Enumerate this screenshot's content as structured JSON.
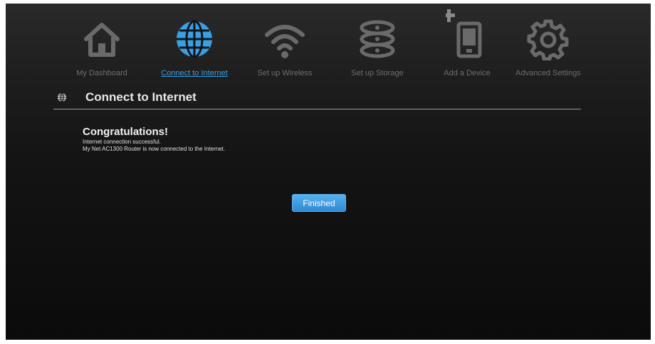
{
  "nav": {
    "items": [
      {
        "label": "My Dashboard",
        "icon": "home-icon",
        "active": false
      },
      {
        "label": "Connect to Internet",
        "icon": "globe-icon",
        "active": true
      },
      {
        "label": "Set up Wireless",
        "icon": "wifi-icon",
        "active": false
      },
      {
        "label": "Set up Storage",
        "icon": "storage-icon",
        "active": false
      },
      {
        "label": "Add a Device",
        "icon": "add-device-icon",
        "active": false
      },
      {
        "label": "Advanced Settings",
        "icon": "gear-icon",
        "active": false
      }
    ]
  },
  "page": {
    "title": "Connect to Internet",
    "icon": "globe-icon"
  },
  "message": {
    "heading": "Congratulations!",
    "line1": "Internet connection successful.",
    "line2": "My Net AC1300 Router is now connected to the Internet."
  },
  "actions": {
    "finish_label": "Finished"
  },
  "colors": {
    "accent": "#3aa0e6",
    "icon_inactive": "#6a6a6a",
    "button": "#3a94dc"
  }
}
